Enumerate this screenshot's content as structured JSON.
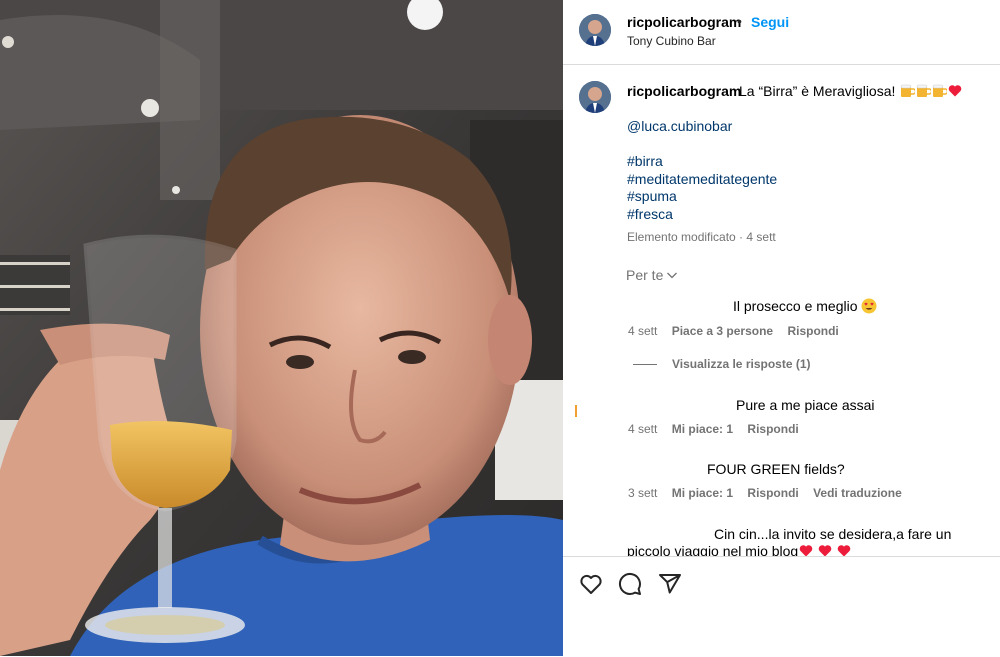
{
  "post": {
    "username": "ricpolicarbogram",
    "follow_label": "Segui",
    "location": "Tony Cubino Bar"
  },
  "caption": {
    "username": "ricpolicarbogram",
    "text": "La “Birra” è Meravigliosa!",
    "mention": "@luca.cubinobar",
    "hashtags": [
      "#birra",
      "#meditatemeditategente",
      "#spuma",
      "#fresca"
    ],
    "meta": "Elemento modificato · 4 sett"
  },
  "filter_label": "Per te",
  "comments": [
    {
      "text": "Il prosecco e meglio",
      "time": "4 sett",
      "likes": "Piace a 3 persone",
      "reply": "Rispondi"
    },
    {
      "text": "Pure a me piace assai",
      "time": "4 sett",
      "likes": "Mi piace: 1",
      "reply": "Rispondi"
    },
    {
      "text": "FOUR GREEN fields?",
      "time": "3 sett",
      "likes": "Mi piace: 1",
      "reply": "Rispondi",
      "translate": "Vedi traduzione"
    },
    {
      "text": "Cin cin...la invito se desidera,a fare un piccolo viaggio nel mio blog"
    }
  ],
  "view_replies": "Visualizza le risposte (1)",
  "icons": {
    "like": "heart-outline-icon",
    "comment": "comment-bubble-icon",
    "share": "paper-plane-icon",
    "filter": "chevron-down-icon"
  },
  "colors": {
    "accent": "#0095f6",
    "link": "#00376b",
    "muted": "#737373",
    "heart": "#ed1c3a"
  }
}
